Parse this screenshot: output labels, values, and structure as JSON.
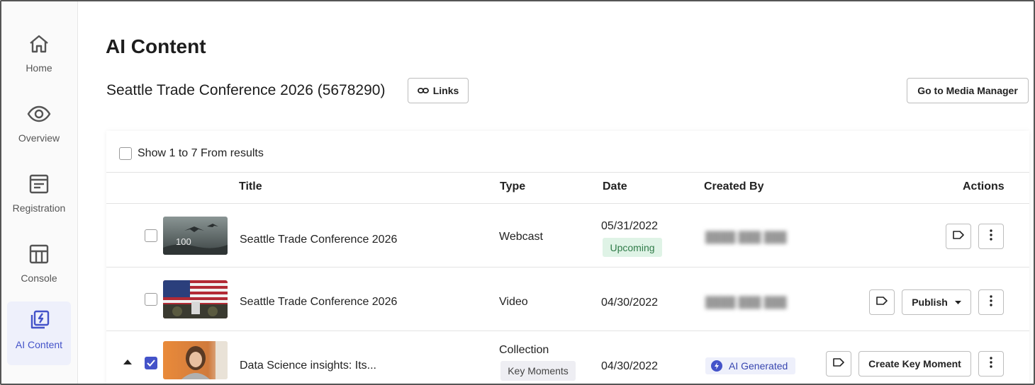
{
  "sidebar": {
    "items": [
      {
        "label": "Home",
        "icon": "home-icon"
      },
      {
        "label": "Overview",
        "icon": "eye-icon"
      },
      {
        "label": "Registration",
        "icon": "form-icon"
      },
      {
        "label": "Console",
        "icon": "layout-icon"
      },
      {
        "label": "AI Content",
        "icon": "ai-content-icon",
        "active": true
      }
    ]
  },
  "header": {
    "page_title": "AI Content",
    "event_title": "Seattle Trade Conference 2026 (5678290)",
    "links_label": "Links",
    "media_manager_label": "Go to Media Manager"
  },
  "table": {
    "select_label": "Show 1 to 7 From results",
    "columns": {
      "title": "Title",
      "type": "Type",
      "date": "Date",
      "created_by": "Created By",
      "actions": "Actions"
    },
    "rows": [
      {
        "title": "Seattle Trade Conference 2026",
        "type": "Webcast",
        "date": "05/31/2022",
        "status": "Upcoming",
        "created_by": "",
        "checked": false,
        "thumbnail_text": "100"
      },
      {
        "title": "Seattle Trade Conference 2026",
        "type": "Video",
        "date": "04/30/2022",
        "created_by": "",
        "checked": false,
        "publish_label": "Publish"
      },
      {
        "title": "Data Science insights: Its...",
        "type": "Collection",
        "subtype": "Key Moments",
        "date": "04/30/2022",
        "created_by": "AI Generated",
        "checked": true,
        "create_key_moment_label": "Create Key Moment"
      }
    ]
  },
  "colors": {
    "accent": "#4453c9",
    "upcoming_bg": "#dff3e6",
    "upcoming_text": "#2f7b48",
    "ai_bg": "#eef0fb"
  }
}
